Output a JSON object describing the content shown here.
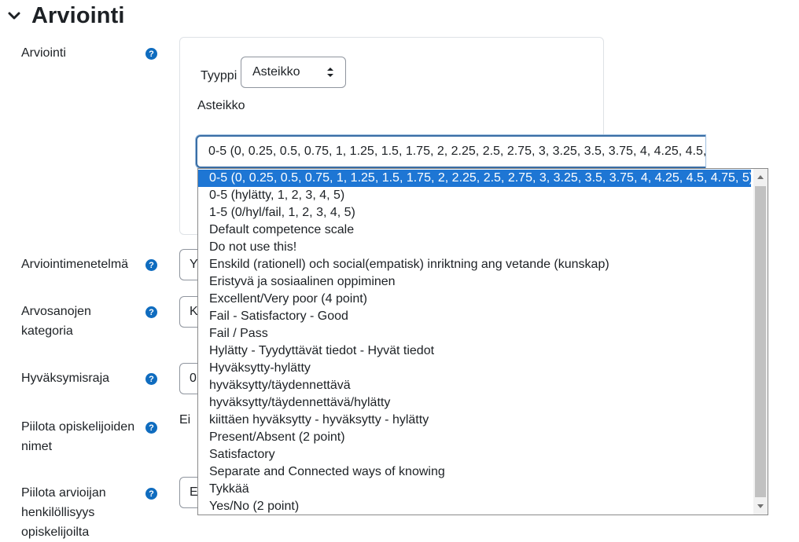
{
  "section": {
    "title": "Arviointi"
  },
  "fields": {
    "arviointi": {
      "label": "Arviointi"
    },
    "tyyppi": {
      "label": "Tyyppi",
      "value": "Asteikko"
    },
    "asteikko": {
      "label": "Asteikko",
      "value": "0-5 (0, 0.25, 0.5, 0.75, 1, 1.25, 1.5, 1.75, 2, 2.25, 2.5, 2.75, 3, 3.25, 3.5, 3.75, 4, 4.25, 4.5, 4.75, 5)"
    },
    "arviointimenetelma": {
      "label": "Arviointimenetelmä",
      "value_partial": "Y"
    },
    "arvosanojen_kategoria": {
      "label_line1": "Arvosanojen",
      "label_line2": "kategoria",
      "value_partial": "K"
    },
    "hyvaksymisraja": {
      "label": "Hyväksymisraja",
      "value_partial": "0"
    },
    "piilota_opiskelijoiden": {
      "label_line1": "Piilota opiskelijoiden",
      "label_line2": "nimet",
      "value": "Ei"
    },
    "piilota_arvioijan": {
      "label_line1": "Piilota arvioijan",
      "label_line2": "henkilöllisyys",
      "label_line3": "opiskelijoilta",
      "value_partial": "E"
    }
  },
  "dropdown_options": [
    "0-5 (0, 0.25, 0.5, 0.75, 1, 1.25, 1.5, 1.75, 2, 2.25, 2.5, 2.75, 3, 3.25, 3.5, 3.75, 4, 4.25, 4.5, 4.75, 5)",
    "0-5 (hylätty, 1, 2, 3, 4, 5)",
    "1-5 (0/hyl/fail, 1, 2, 3, 4, 5)",
    "Default competence scale",
    "Do not use this!",
    "Enskild (rationell) och social(empatisk) inriktning ang vetande (kunskap)",
    "Eristyvä ja sosiaalinen oppiminen",
    "Excellent/Very poor (4 point)",
    "Fail - Satisfactory - Good",
    "Fail / Pass",
    "Hylätty - Tyydyttävät tiedot - Hyvät tiedot",
    "Hyväksytty-hylätty",
    "hyväksytty/täydennettävä",
    "hyväksytty/täydennettävä/hylätty",
    "kiittäen hyväksytty - hyväksytty - hylätty",
    "Present/Absent (2 point)",
    "Satisfactory",
    "Separate and Connected ways of knowing",
    "Tykkää",
    "Yes/No (2 point)"
  ],
  "help_icon": "question-circle-icon",
  "colors": {
    "accent": "#0f6cbf",
    "selected_option": "#1e76d4",
    "focus_border": "#3a6ea5"
  }
}
